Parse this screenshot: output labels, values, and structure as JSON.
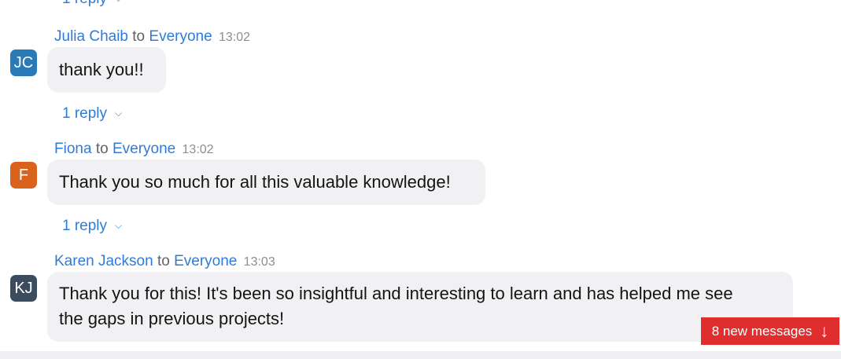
{
  "messages": [
    {
      "sender": "Julia Chaib",
      "to_word": "to",
      "recipient": "Everyone",
      "time": "13:02",
      "initials": "JC",
      "avatar_color": "#2a7ab8",
      "text": "thank you!!",
      "reply_label": "1 reply"
    },
    {
      "sender": "Fiona",
      "to_word": "to",
      "recipient": "Everyone",
      "time": "13:02",
      "initials": "F",
      "avatar_color": "#d9621c",
      "text": "Thank you so much for all this valuable knowledge!",
      "reply_label": "1 reply"
    },
    {
      "sender": "Karen Jackson",
      "to_word": "to",
      "recipient": "Everyone",
      "time": "13:03",
      "initials": "KJ",
      "avatar_color": "#3c4b5e",
      "text_line1": "Thank you for this! It's been so insightful and interesting to learn and has helped me see",
      "text_line2": "the gaps in previous projects!"
    }
  ],
  "top_reply_label": "1 reply",
  "new_messages_label": "8 new messages",
  "icons": {
    "chevron": "chevron-down-icon",
    "arrow": "arrow-down-icon"
  },
  "colors": {
    "link": "#2f7bd7",
    "bubble": "#f1f1f4",
    "new_messages_bg": "#e02d2d"
  }
}
